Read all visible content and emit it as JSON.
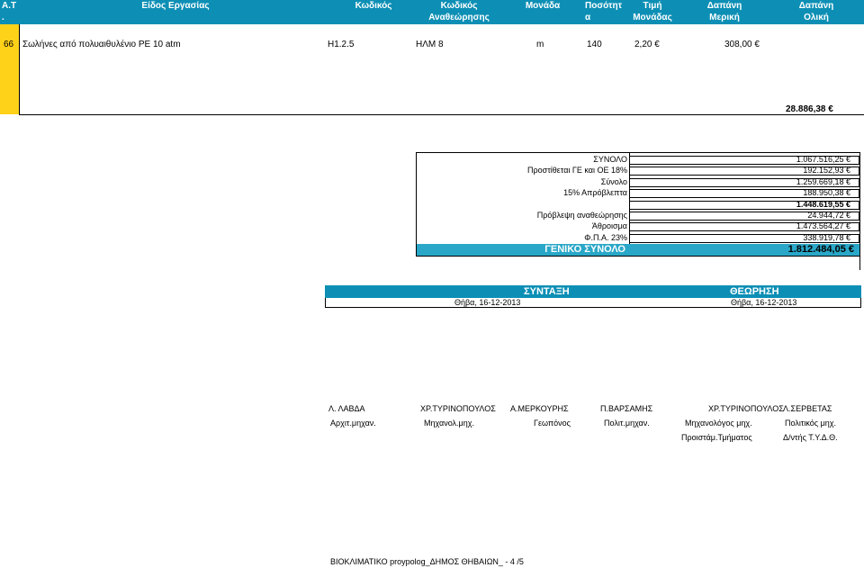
{
  "header": {
    "aa": "Α.Τ",
    "aa_dot": ".",
    "work_type": "Είδος Εργασίας",
    "code": "Κωδικός",
    "rev_code_l1": "Κωδικός",
    "rev_code_l2": "Αναθεώρησης",
    "unit": "Μονάδα",
    "qty_l1": "Ποσότητ",
    "qty_l2": "α",
    "price_l1": "Τιμή",
    "price_l2": "Μονάδας",
    "partial_l1": "Δαπάνη",
    "partial_l2": "Μερική",
    "total_l1": "Δαπάνη",
    "total_l2": "Ολική"
  },
  "row": {
    "aa": "66",
    "description": "Σωλήνες από πολυαιθυλένιο PE 10 atm",
    "code": "Η1.2.5",
    "rev_code": "ΗΛΜ 8",
    "unit": "m",
    "qty": "140",
    "price": "2,20",
    "partial": "308,00"
  },
  "page_total": "28.886,38",
  "euro": "€",
  "summary": {
    "rows": [
      {
        "label": "ΣΥΝΟΛΟ",
        "value": "1.067.516,25"
      },
      {
        "label": "Προστίθεται ΓΕ και ΟΕ  18%",
        "value": "192.152,93"
      },
      {
        "label": "Σύνολο",
        "value": "1.259.669,18"
      },
      {
        "label": "15% Απρόβλεπτα",
        "value": "188.950,38"
      },
      {
        "label": "",
        "value": "1.448.619,55"
      },
      {
        "label": "Πρόβλεψη αναθεώρησης",
        "value": "24.944,72"
      },
      {
        "label": "Άθροισμα",
        "value": "1.473.564,27"
      },
      {
        "label": "Φ.Π.Α.  23%",
        "value": "338.919,78"
      }
    ],
    "grand_label": "ΓΕΝΙΚΟ ΣΥΝΟΛΟ",
    "grand_value": "1.812.484,05"
  },
  "signatures": {
    "left_title": "ΣΥΝΤΑΞΗ",
    "right_title": "ΘΕΩΡΗΣΗ",
    "left_date": "Θήβα, 16-12-2013",
    "right_date": "Θήβα, 16-12-2013",
    "people": [
      {
        "name": "Λ. ΛΑΒΔΑ",
        "role": "Αρχιτ.μηχαν.",
        "role2": ""
      },
      {
        "name": "ΧΡ.ΤΥΡΙΝΟΠΟΥΛΟΣ",
        "role": "Μηχανολ.μηχ.",
        "role2": ""
      },
      {
        "name": "Α.ΜΕΡΚΟΥΡΗΣ",
        "role": "Γεωπόνος",
        "role2": ""
      },
      {
        "name": "Π.ΒΑΡΣΑΜΗΣ",
        "role": "Πολιτ.μηχαν.",
        "role2": ""
      },
      {
        "name": "ΧΡ.ΤΥΡΙΝΟΠΟΥΛΟΣ",
        "role": "Μηχανολόγος μηχ.",
        "role2": "Προιστάμ.Τμήματος"
      },
      {
        "name": "Λ.ΣΕΡΒΕΤΑΣ",
        "role": "Πολιτικός μηχ.",
        "role2": "Δ/ντής Τ.Υ.Δ.Θ."
      }
    ]
  },
  "footer": "ΒΙΟΚΛΙΜΑΤΙΚΟ proypolog_ΔΗΜΟΣ ΘΗΒΑΙΩΝ_  -  4 /5"
}
